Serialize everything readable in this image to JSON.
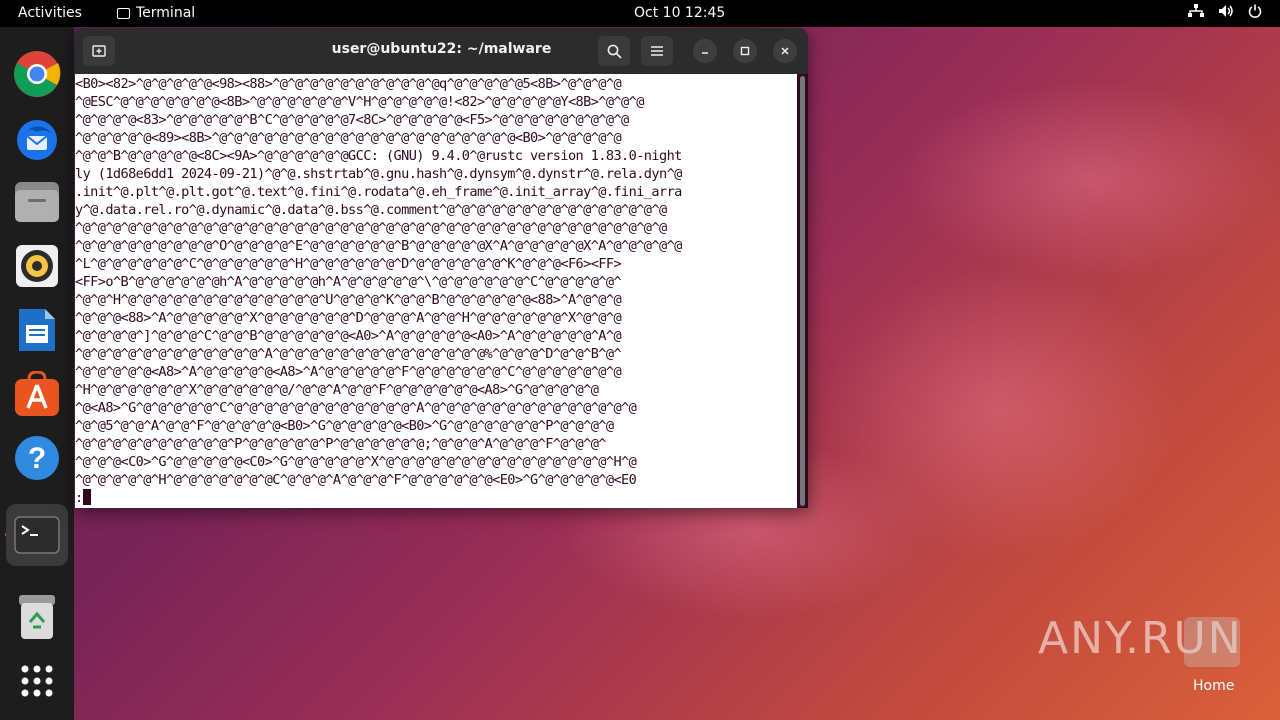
{
  "topbar": {
    "activities": "Activities",
    "app_name": "Terminal",
    "clock": "Oct 10  12:45",
    "tray_icons": [
      "network-icon",
      "volume-icon",
      "power-icon"
    ]
  },
  "dock": {
    "apps": [
      "chrome-icon",
      "thunderbird-icon",
      "files-icon",
      "rhythmbox-icon",
      "writer-icon",
      "app-center-icon",
      "help-icon",
      "terminal-icon",
      "trash-icon",
      "show-apps-icon"
    ]
  },
  "window": {
    "title": "user@ubuntu22: ~/malware"
  },
  "terminal": {
    "lines": [
      "<B0><82>^@^@^@^@^@<98><88>^@^@^@^@^@^@^@^@^@^@^@q^@^@^@^@^@5<8B>^@^@^@^@",
      "^@ESC^@^@^@^@^@^@^@<8B>^@^@^@^@^@^@^V^H^@^@^@^@^@!<82>^@^@^@^@^@Y<8B>^@^@^@",
      "^@^@^@^@<83>^@^@^@^@^@^B^C^@^@^@^@^@7<8C>^@^@^@^@^@<F5>^@^@^@^@^@^@^@^@^@",
      "^@^@^@^@^@<89><8B>^@^@^@^@^@^@^@^@^@^@^@^@^@^@^@^@^@^@^@^@<B0>^@^@^@^@^@",
      "^@^@^B^@^@^@^@^@<8C><9A>^@^@^@^@^@^@GCC: (GNU) 9.4.0^@rustc version 1.83.0-night",
      "ly (1d68e6dd1 2024-09-21)^@^@.shstrtab^@.gnu.hash^@.dynsym^@.dynstr^@.rela.dyn^@",
      ".init^@.plt^@.plt.got^@.text^@.fini^@.rodata^@.eh_frame^@.init_array^@.fini_arra",
      "y^@.data.rel.ro^@.dynamic^@.data^@.bss^@.comment^@^@^@^@^@^@^@^@^@^@^@^@^@^@^@",
      "^@^@^@^@^@^@^@^@^@^@^@^@^@^@^@^@^@^@^@^@^@^@^@^@^@^@^@^@^@^@^@^@^@^@^@^@^@^@^@",
      "^@^@^@^@^@^@^@^@^@^O^@^@^@^@^E^@^@^@^@^@^@^B^@^@^@^@^@X^A^@^@^@^@^@X^A^@^@^@^@^@",
      "^L^@^@^@^@^@^@^C^@^@^@^@^@^@^H^@^@^@^@^@^@^D^@^@^@^@^@^@^K^@^@^@<F6><FF>",
      "<FF>o^B^@^@^@^@^@^@h^A^@^@^@^@^@h^A^@^@^@^@^@^\\^@^@^@^@^@^@^C^@^@^@^@^@^",
      "^@^@^H^@^@^@^@^@^@^@^@^@^@^@^@^@^U^@^@^@^K^@^@^B^@^@^@^@^@^@<88>^A^@^@^@",
      "^@^@^@<88>^A^@^@^@^@^@^X^@^@^@^@^@^@^D^@^@^@^A^@^@^H^@^@^@^@^@^@^X^@^@^@",
      "^@^@^@^@^]^@^@^@^C^@^@^B^@^@^@^@^@^@<A0>^A^@^@^@^@^@<A0>^A^@^@^@^@^@^A^@",
      "^@^@^@^@^@^@^@^@^@^@^@^@^A^@^@^@^@^@^@^@^@^@^@^@^@^@^@%^@^@^@^D^@^@^B^@^",
      "^@^@^@^@^@<A8>^A^@^@^@^@^@<A8>^A^@^@^@^@^@^F^@^@^@^@^@^@^C^@^@^@^@^@^@^@",
      "^H^@^@^@^@^@^@^X^@^@^@^@^@^@/^@^@^A^@^@^F^@^@^@^@^@^@<A8>^G^@^@^@^@^@",
      "^@<A8>^G^@^@^@^@^@^C^@^@^@^@^@^@^@^@^@^@^@^@^A^@^@^@^@^@^@^@^@^@^@^@^@^@^@",
      "^@^@5^@^@^A^@^@^F^@^@^@^@^@<B0>^G^@^@^@^@^@<B0>^G^@^@^@^@^@^@^P^@^@^@^@",
      "^@^@^@^@^@^@^@^@^@^@^P^@^@^@^@^@^P^@^@^@^@^@^@;^@^@^@^A^@^@^@^F^@^@^@^",
      "^@^@^@<C0>^G^@^@^@^@^@<C0>^G^@^@^@^@^@^X^@^@^@^@^@^@^@^@^@^@^@^@^@^@^@^H^@",
      "^@^@^@^@^@^H^@^@^@^@^@^@^@C^@^@^@^A^@^@^@^F^@^@^@^@^@^@<E0>^G^@^@^@^@^@<E0"
    ],
    "prompt": ":"
  },
  "watermark": {
    "text": "ANY.RUN",
    "home_label": "Home"
  }
}
